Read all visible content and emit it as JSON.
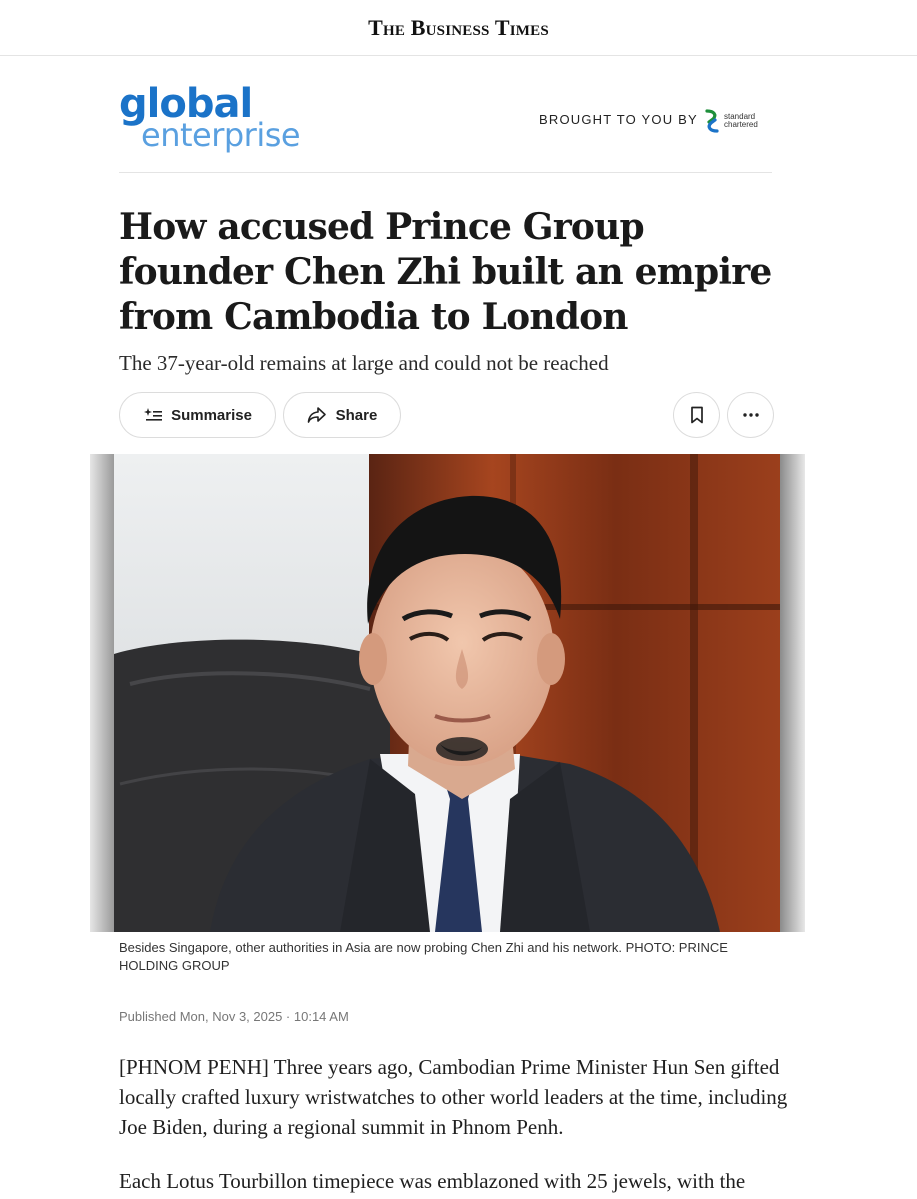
{
  "masthead": {
    "title": "The Business Times"
  },
  "sponsor": {
    "section_logo_line1": "global",
    "section_logo_line2": "enterprise",
    "brought_label": "BROUGHT TO YOU BY",
    "sponsor_line1": "standard",
    "sponsor_line2": "chartered"
  },
  "article": {
    "headline": "How accused Prince Group founder Chen Zhi built an empire from Cambodia to London",
    "standfirst": "The 37-year-old remains at large and could not be reached",
    "actions": {
      "summarise_label": "Summarise",
      "share_label": "Share",
      "summarise_icon": "sparkle-list-icon",
      "share_icon": "share-arrow-icon",
      "bookmark_icon": "bookmark-icon",
      "more_icon": "more-dots-icon"
    },
    "image": {
      "caption": "Besides Singapore, other authorities in Asia are now probing Chen Zhi and his network. PHOTO: PRINCE HOLDING GROUP"
    },
    "published": "Published Mon, Nov 3, 2025 · 10:14 AM",
    "paragraphs": [
      "[PHNOM PENH] Three years ago, Cambodian Prime Minister Hun Sen gifted locally crafted luxury wristwatches to other world leaders at the time, including Joe Biden, during a regional summit in Phnom Penh.",
      "Each Lotus Tourbillon timepiece was emblazoned with 25 jewels, with the"
    ]
  },
  "colors": {
    "brand_blue": "#1b73c8",
    "brand_light_blue": "#5aa0e0",
    "border": "#dcdcdc",
    "muted_text": "#777777"
  }
}
